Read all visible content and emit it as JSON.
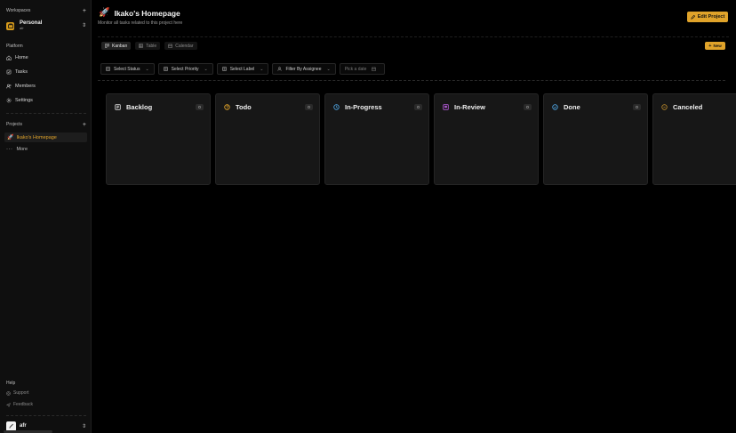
{
  "sidebar": {
    "workspaces_label": "Workspaces",
    "workspace": {
      "name": "Personal",
      "sub": "afr"
    },
    "platform_label": "Platform",
    "nav": [
      {
        "label": "Home",
        "icon": "home-icon"
      },
      {
        "label": "Tasks",
        "icon": "tasks-icon"
      },
      {
        "label": "Members",
        "icon": "members-icon"
      },
      {
        "label": "Settings",
        "icon": "gear-icon"
      }
    ],
    "projects_label": "Projects",
    "project": {
      "label": "Ikako's Homepage",
      "icon": "rocket-icon"
    },
    "more_label": "More",
    "help_label": "Help",
    "support_label": "Support",
    "feedback_label": "Feedback",
    "user_name": "afr"
  },
  "header": {
    "title": "Ikako's Homepage",
    "subtitle": "Monitor all tasks related to this project here",
    "edit_label": "Edit Project"
  },
  "views": [
    {
      "label": "Kanban",
      "active": true
    },
    {
      "label": "Table",
      "active": false
    },
    {
      "label": "Calendar",
      "active": false
    }
  ],
  "new_label": "New",
  "filters": {
    "status": "Select Status",
    "priority": "Select Priority",
    "label": "Select Label",
    "assignee": "Filter By Assignee",
    "date_placeholder": "Pick a date"
  },
  "columns": [
    {
      "title": "Backlog",
      "count": "0",
      "icon": "backlog-icon",
      "color": "#d8d8d8"
    },
    {
      "title": "Todo",
      "count": "0",
      "icon": "todo-icon",
      "color": "#e0a32a"
    },
    {
      "title": "In-Progress",
      "count": "0",
      "icon": "in-progress-icon",
      "color": "#4ea3e0"
    },
    {
      "title": "In-Review",
      "count": "0",
      "icon": "in-review-icon",
      "color": "#b45ad8"
    },
    {
      "title": "Done",
      "count": "0",
      "icon": "done-icon",
      "color": "#4ea3e0"
    },
    {
      "title": "Canceled",
      "count": "",
      "icon": "canceled-icon",
      "color": "#b5852a"
    }
  ],
  "colors": {
    "accent": "#e0a32a",
    "sidebar_bg": "#0f0f0f",
    "column_bg": "#171717"
  }
}
